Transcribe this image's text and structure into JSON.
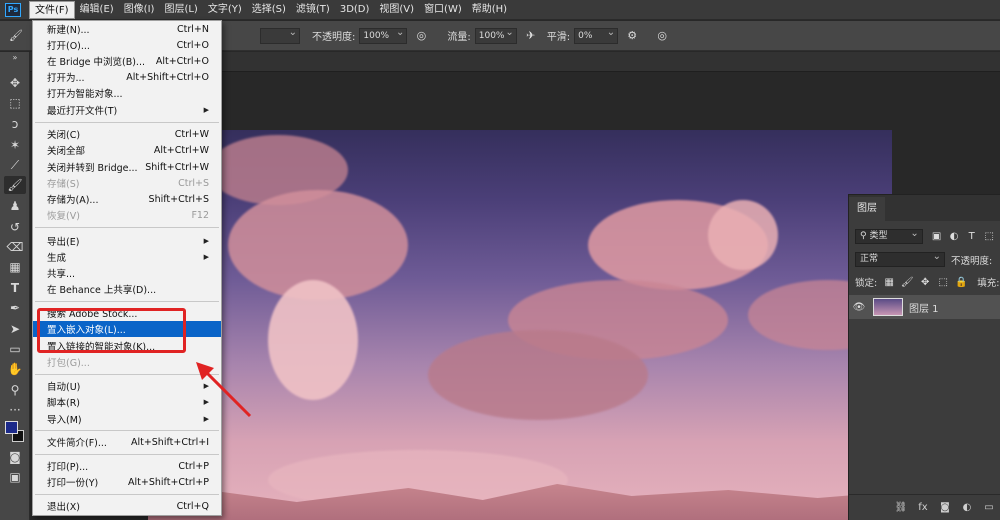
{
  "app": {
    "logo": "Ps",
    "accent": "#31a8ff"
  },
  "menubar": {
    "items": [
      "文件(F)",
      "编辑(E)",
      "图像(I)",
      "图层(L)",
      "文字(Y)",
      "选择(S)",
      "滤镜(T)",
      "3D(D)",
      "视图(V)",
      "窗口(W)",
      "帮助(H)"
    ],
    "active_index": 0
  },
  "options": {
    "opacity_label": "不透明度:",
    "opacity_value": "100%",
    "flow_label": "流量:",
    "flow_value": "100%",
    "smooth_label": "平滑:",
    "smooth_value": "0%"
  },
  "file_menu": {
    "items": [
      {
        "label": "新建(N)...",
        "shortcut": "Ctrl+N"
      },
      {
        "label": "打开(O)...",
        "shortcut": "Ctrl+O"
      },
      {
        "label": "在 Bridge 中浏览(B)...",
        "shortcut": "Alt+Ctrl+O"
      },
      {
        "label": "打开为...",
        "shortcut": "Alt+Shift+Ctrl+O"
      },
      {
        "label": "打开为智能对象...",
        "shortcut": ""
      },
      {
        "label": "最近打开文件(T)",
        "shortcut": "",
        "submenu": true
      },
      {
        "label": "关闭(C)",
        "shortcut": "Ctrl+W"
      },
      {
        "label": "关闭全部",
        "shortcut": "Alt+Ctrl+W"
      },
      {
        "label": "关闭并转到 Bridge...",
        "shortcut": "Shift+Ctrl+W"
      },
      {
        "label": "存储(S)",
        "shortcut": "Ctrl+S",
        "disabled": true
      },
      {
        "label": "存储为(A)...",
        "shortcut": "Shift+Ctrl+S"
      },
      {
        "label": "恢复(V)",
        "shortcut": "F12",
        "disabled": true
      },
      {
        "label": "导出(E)",
        "shortcut": "",
        "submenu": true
      },
      {
        "label": "生成",
        "shortcut": "",
        "submenu": true
      },
      {
        "label": "共享...",
        "shortcut": ""
      },
      {
        "label": "在 Behance 上共享(D)...",
        "shortcut": ""
      },
      {
        "label": "搜索 Adobe Stock...",
        "shortcut": ""
      },
      {
        "label": "置入嵌入对象(L)...",
        "shortcut": "",
        "highlight": true
      },
      {
        "label": "置入链接的智能对象(K)...",
        "shortcut": ""
      },
      {
        "label": "打包(G)...",
        "shortcut": "",
        "disabled": true
      },
      {
        "label": "自动(U)",
        "shortcut": "",
        "submenu": true
      },
      {
        "label": "脚本(R)",
        "shortcut": "",
        "submenu": true
      },
      {
        "label": "导入(M)",
        "shortcut": "",
        "submenu": true
      },
      {
        "label": "文件简介(F)...",
        "shortcut": "Alt+Shift+Ctrl+I"
      },
      {
        "label": "打印(P)...",
        "shortcut": "Ctrl+P"
      },
      {
        "label": "打印一份(Y)",
        "shortcut": "Alt+Shift+Ctrl+P"
      },
      {
        "label": "退出(X)",
        "shortcut": "Ctrl+Q"
      }
    ]
  },
  "layers_panel": {
    "tab": "图层",
    "filter_value": "类型",
    "blend_mode": "正常",
    "opacity_label": "不透明度:",
    "lock_label": "锁定:",
    "fill_label": "填充:",
    "layer_name": "图层 1"
  },
  "colors": {
    "highlight": "#0a64c8",
    "annotation": "#e02323",
    "foreground": "#1c2a8a"
  }
}
